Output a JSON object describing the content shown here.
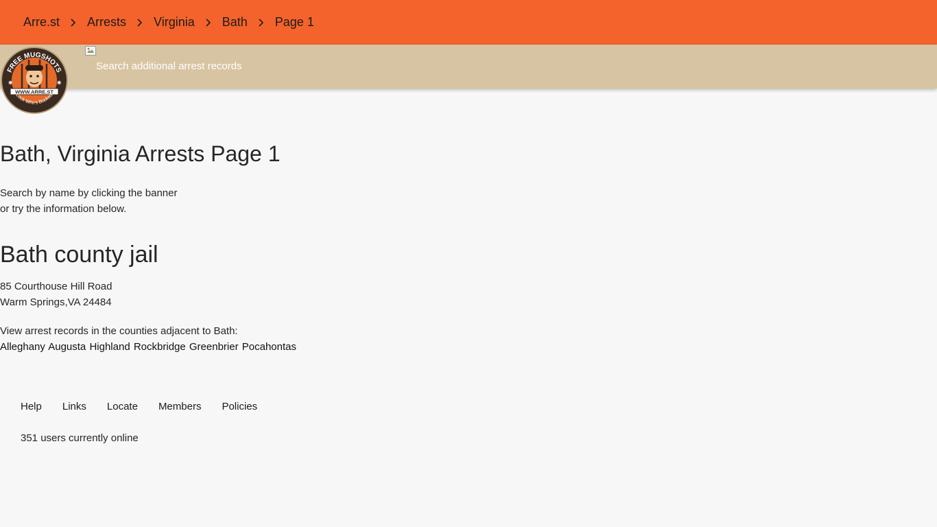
{
  "breadcrumb": [
    "Arre.st",
    "Arrests",
    "Virginia",
    "Bath",
    "Page 1"
  ],
  "banner": {
    "link_text": "Search additional arrest records"
  },
  "logo": {
    "top_text": "FREE MUGSHOTS",
    "url_text": "WWW.ARRE.ST",
    "bottom_text": "Look Who's Booked"
  },
  "main": {
    "title": "Bath, Virginia Arrests Page 1",
    "intro_line1": "Search by name by clicking the banner",
    "intro_line2": "or try the information below.",
    "jail_title": "Bath county jail",
    "address_line1": "85 Courthouse Hill Road",
    "address_line2": "Warm Springs,VA 24484",
    "adjacent_label": "View arrest records in the counties adjacent to Bath:",
    "adjacent_counties": [
      "Alleghany",
      "Augusta",
      "Highland",
      "Rockbridge",
      "Greenbrier",
      "Pocahontas"
    ]
  },
  "footer": {
    "links": [
      "Help",
      "Links",
      "Locate",
      "Members",
      "Policies"
    ],
    "online_text": "351 users currently online"
  },
  "colors": {
    "topbar": "#f4632b",
    "banner": "#d7c4a2",
    "background": "#f8f7f7"
  }
}
